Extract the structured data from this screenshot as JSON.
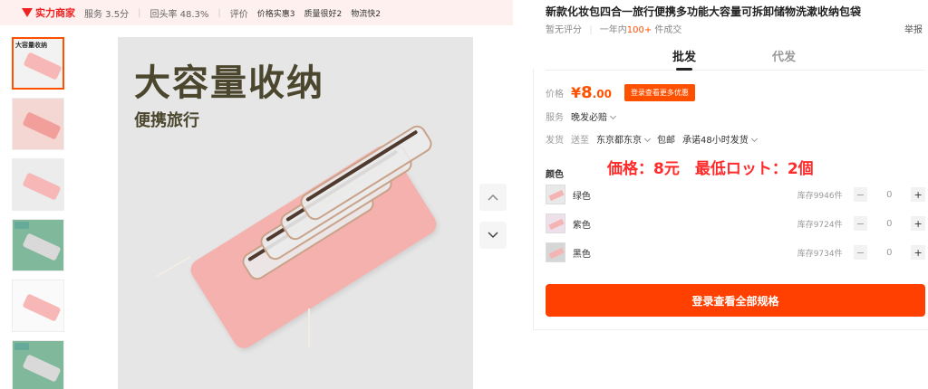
{
  "shop": {
    "badge": "实力商家",
    "service": "服务 3.5分",
    "repurchase": "回头率 48.3%",
    "rating_label": "评价",
    "tags": [
      "价格实惠3",
      "质量很好2",
      "物流快2"
    ]
  },
  "thumbnails": [
    {
      "label": "大容量收纳",
      "selected": true
    },
    {
      "label": "",
      "selected": false
    },
    {
      "label": "",
      "selected": false
    },
    {
      "label": "",
      "selected": false
    },
    {
      "label": "",
      "selected": false
    },
    {
      "label": "",
      "selected": false
    }
  ],
  "main_image": {
    "headline": "大容量收纳",
    "subline": "便携旅行"
  },
  "product": {
    "title": "新款化妆包四合一旅行便携多功能大容量可拆卸储物洗漱收纳包袋",
    "no_rating": "暂无评分",
    "sold_prefix": "一年内",
    "sold_num": "100+",
    "sold_suffix": " 件成交",
    "report": "举报"
  },
  "tabs": [
    "批发",
    "代发"
  ],
  "price": {
    "label": "价格",
    "symbol": "¥",
    "integer": "8",
    "decimal": ".00",
    "more_button": "登录查看更多优惠"
  },
  "service": {
    "label": "服务",
    "value": "晚发必赔"
  },
  "shipping": {
    "label": "发货",
    "to": "送至",
    "dest": "东京都东京",
    "free": "包邮",
    "promise": "承诺48小时发货"
  },
  "annotation": "価格：8元　最低ロット：2個",
  "colors": {
    "label": "颜色",
    "items": [
      {
        "name": "绿色",
        "stock": "库存9946件",
        "qty": "0"
      },
      {
        "name": "紫色",
        "stock": "库存9724件",
        "qty": "0"
      },
      {
        "name": "黑色",
        "stock": "库存9734件",
        "qty": "0"
      }
    ]
  },
  "login_button": "登录查看全部规格",
  "icons": {
    "up": "chevron-up-icon",
    "down": "chevron-down-icon",
    "minus": "minus-icon",
    "plus": "plus-icon"
  },
  "accent_color": "#ff5000"
}
